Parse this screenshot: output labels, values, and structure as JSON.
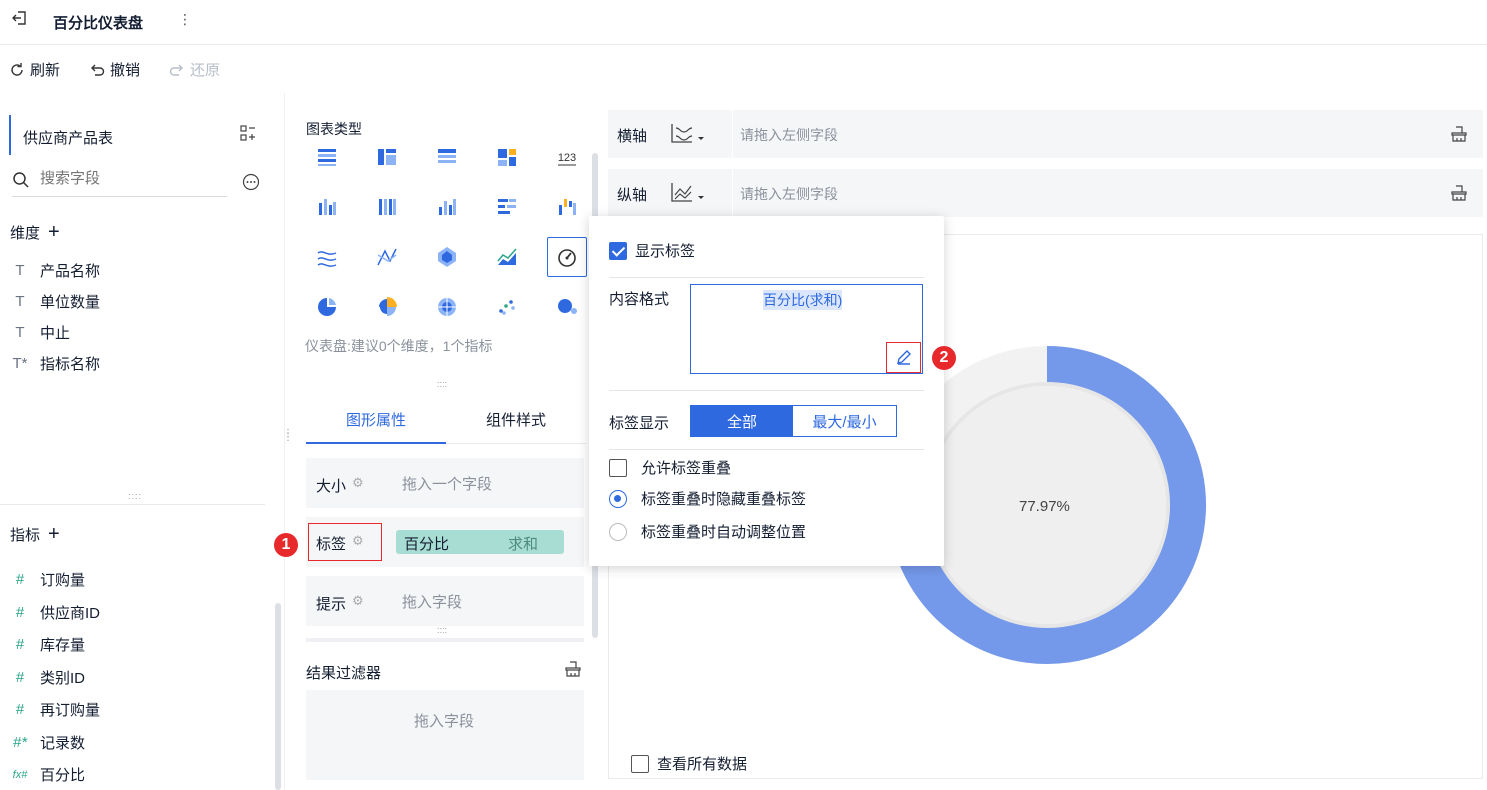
{
  "header": {
    "title": "百分比仪表盘",
    "more": "⋮"
  },
  "toolbar": {
    "refresh": "刷新",
    "undo": "撤销",
    "redo": "还原"
  },
  "left": {
    "dataset_name": "供应商产品表",
    "search_placeholder": "搜索字段",
    "dimension_title": "维度",
    "dimensions": [
      {
        "icon": "T",
        "label": "产品名称"
      },
      {
        "icon": "T",
        "label": "单位数量"
      },
      {
        "icon": "T",
        "label": "中止"
      },
      {
        "icon": "T*",
        "label": "指标名称"
      }
    ],
    "measure_title": "指标",
    "measures": [
      {
        "icon": "#",
        "label": "订购量"
      },
      {
        "icon": "#",
        "label": "供应商ID"
      },
      {
        "icon": "#",
        "label": "库存量"
      },
      {
        "icon": "#",
        "label": "类别ID"
      },
      {
        "icon": "#",
        "label": "再订购量"
      },
      {
        "icon": "#*",
        "label": "记录数"
      },
      {
        "icon": "fx#",
        "label": "百分比"
      }
    ],
    "divider_handle": "::::"
  },
  "middle": {
    "chart_type_title": "图表类型",
    "chart_tip": "仪表盘:建议0个维度，1个指标",
    "number_icon_text": "123",
    "tabs": [
      {
        "label": "图形属性",
        "active": true
      },
      {
        "label": "组件样式",
        "active": false
      }
    ],
    "props": [
      {
        "label": "大小",
        "value": "拖入一个字段"
      },
      {
        "label": "标签",
        "field": "百分比",
        "agg": "求和"
      },
      {
        "label": "提示",
        "value": "拖入字段"
      }
    ],
    "filter_title": "结果过滤器",
    "filter_placeholder": "拖入字段",
    "handle": "::::"
  },
  "axes": {
    "x_label": "横轴",
    "y_label": "纵轴",
    "placeholder": "请拖入左侧字段"
  },
  "chart": {
    "value_label": "77.97%",
    "percent": 77.97,
    "color_fill": "#7499ea",
    "color_track": "#f0f0f0",
    "view_all": "查看所有数据"
  },
  "popover": {
    "show_label": "显示标签",
    "content_format_label": "内容格式",
    "content_format_value": "百分比(求和)",
    "label_display": "标签显示",
    "seg_all": "全部",
    "seg_minmax": "最大/最小",
    "allow_overlap": "允许标签重叠",
    "hide_overlap": "标签重叠时隐藏重叠标签",
    "auto_adjust": "标签重叠时自动调整位置"
  },
  "badges": {
    "one": "1",
    "two": "2"
  },
  "colors": {
    "accent": "#2e69e0",
    "highlight": "#e8292c",
    "tag_bg": "#a8ddd3"
  }
}
